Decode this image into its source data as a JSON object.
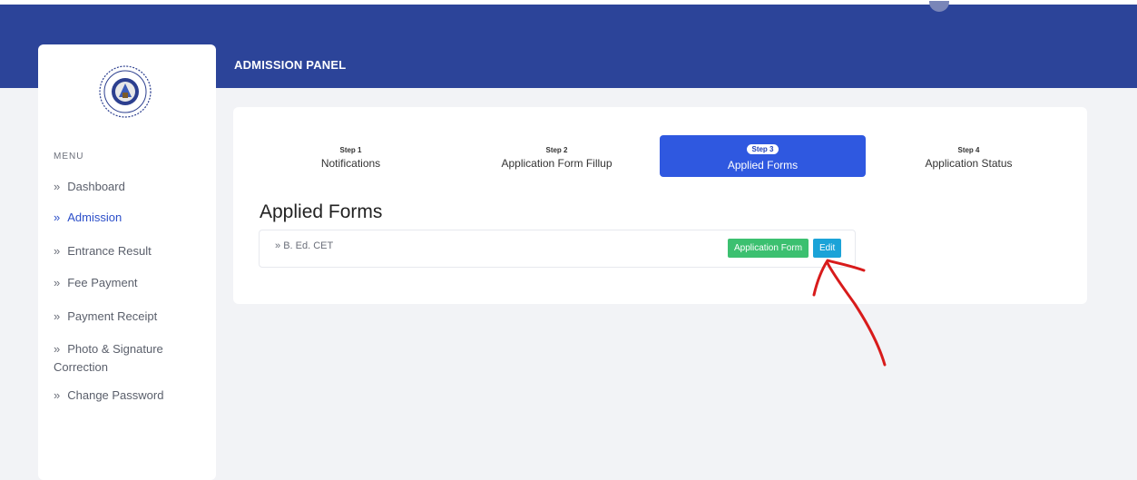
{
  "header": {
    "title": "ADMISSION PANEL"
  },
  "sidebar": {
    "menu_label": "MENU",
    "items": [
      {
        "label": "Dashboard"
      },
      {
        "label": "Admission",
        "active": true
      },
      {
        "label": "Entrance Result"
      },
      {
        "label": "Fee Payment"
      },
      {
        "label": "Payment Receipt"
      },
      {
        "label": "Photo & Signature"
      },
      {
        "label": "Change Password"
      }
    ],
    "photo_continuation": "Correction"
  },
  "steps": [
    {
      "step": "Step 1",
      "title": "Notifications"
    },
    {
      "step": "Step 2",
      "title": "Application Form Fillup"
    },
    {
      "step": "Step 3",
      "title": "Applied Forms",
      "active": true
    },
    {
      "step": "Step 4",
      "title": "Application Status"
    }
  ],
  "main": {
    "section_title": "Applied Forms",
    "forms": [
      {
        "name": "B. Ed. CET",
        "buttons": {
          "application_form": "Application Form",
          "edit": "Edit"
        }
      }
    ]
  },
  "colors": {
    "header": "#2c4499",
    "active_step": "#2f58e0",
    "application_form_button": "#3cc070",
    "edit_button": "#1ba3d8",
    "annotation": "#d81b1b"
  },
  "icons": {
    "menu_chevron": "double-chevron-right-icon",
    "form_chevron": "double-chevron-right-icon"
  }
}
